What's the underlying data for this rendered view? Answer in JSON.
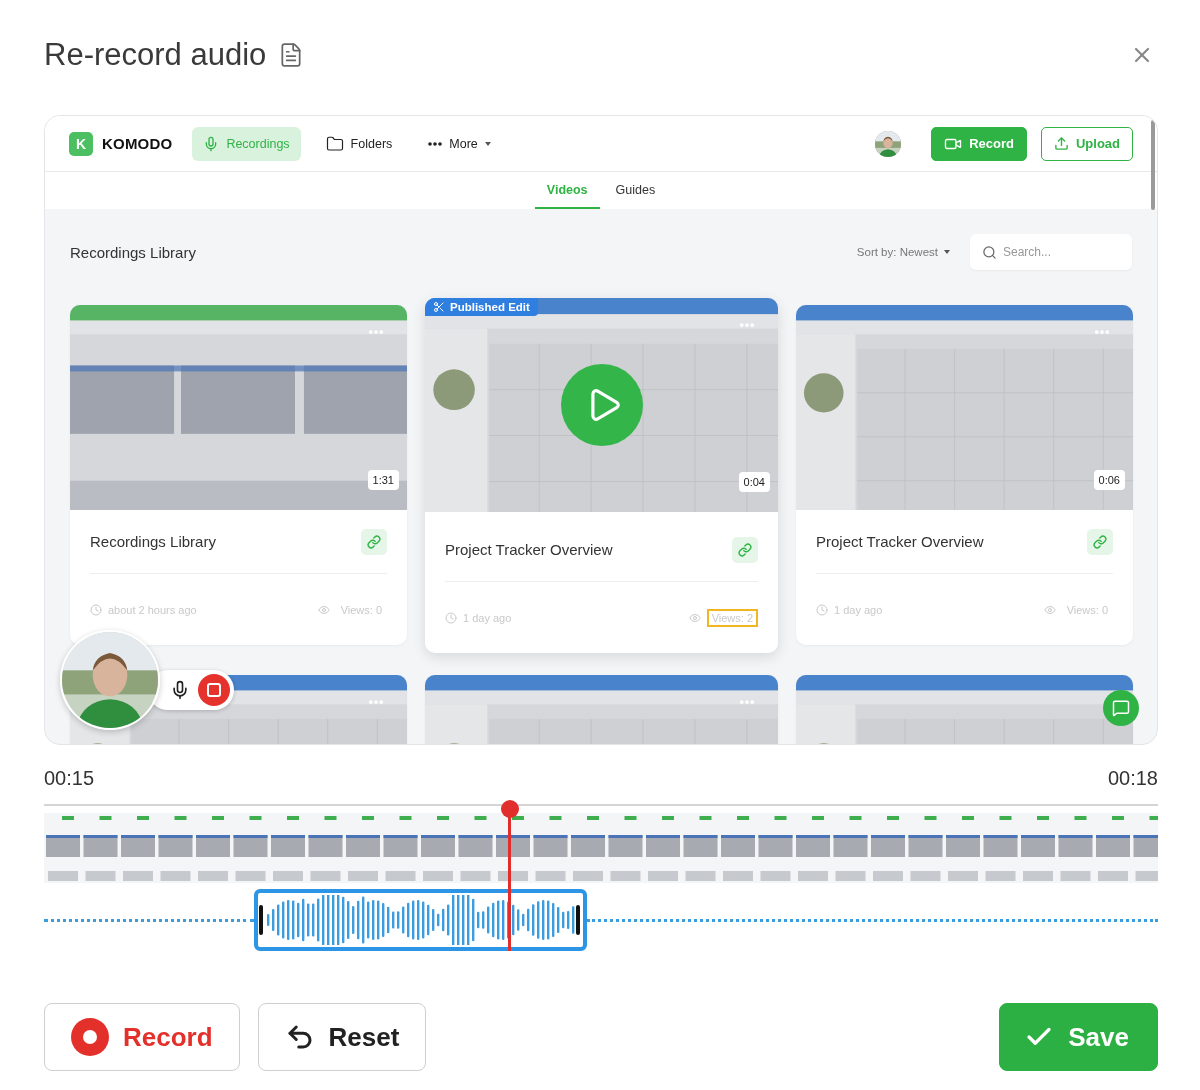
{
  "dialog": {
    "title": "Re-record audio"
  },
  "preview": {
    "brand_mark": "K",
    "brand": "KOMODO",
    "nav": [
      {
        "label": "Recordings",
        "kind": "recordings",
        "selected": true
      },
      {
        "label": "Folders",
        "kind": "folders",
        "selected": false
      },
      {
        "label": "More",
        "kind": "more",
        "selected": false
      }
    ],
    "record_button": "Record",
    "upload_button": "Upload",
    "tabs": [
      {
        "label": "Videos",
        "selected": true
      },
      {
        "label": "Guides",
        "selected": false
      }
    ],
    "library_title": "Recordings Library",
    "sort": "Sort by: Newest",
    "search": {
      "placeholder": "Search..."
    },
    "cards": [
      {
        "kind": "full",
        "title": "Recordings Library",
        "duration": "1:31",
        "time": "about 2 hours ago",
        "views": "Views: 0",
        "hovered": false,
        "views_highlighted": false
      },
      {
        "kind": "full",
        "badge": "Published Edit",
        "title": "Project Tracker Overview",
        "duration": "0:04",
        "time": "1 day ago",
        "views": "Views: 2",
        "hovered": true,
        "views_highlighted": true
      },
      {
        "kind": "full",
        "title": "Project Tracker Overview",
        "duration": "0:06",
        "time": "1 day ago",
        "views": "Views: 0",
        "hovered": false,
        "views_highlighted": false
      },
      {
        "kind": "partial",
        "more_menu": true
      },
      {
        "kind": "partial",
        "more_menu": true
      },
      {
        "kind": "partial",
        "more_menu": false
      }
    ]
  },
  "timeline": {
    "start": "00:15",
    "end": "00:18",
    "playhead": {
      "level": 0.418
    }
  },
  "buttons": [
    {
      "label": "Record",
      "kind": "record"
    },
    {
      "label": "Reset",
      "kind": "reset"
    },
    {
      "label": "Save",
      "kind": "save"
    }
  ]
}
